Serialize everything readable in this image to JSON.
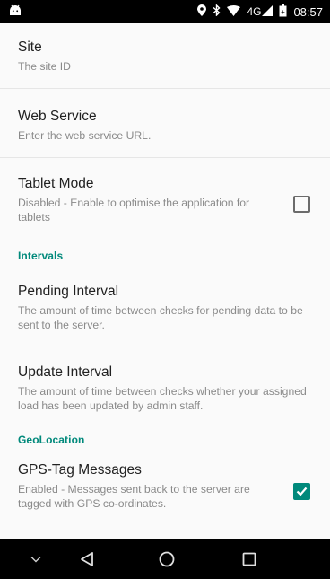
{
  "status_bar": {
    "time": "08:57",
    "network": "4G",
    "icons": [
      "android-icon",
      "location-icon",
      "bluetooth-icon",
      "wifi-icon",
      "signal-icon",
      "battery-icon"
    ]
  },
  "preferences": {
    "site": {
      "title": "Site",
      "summary": "The site ID"
    },
    "web_service": {
      "title": "Web Service",
      "summary": "Enter the web service URL."
    },
    "tablet_mode": {
      "title": "Tablet Mode",
      "summary": "Disabled - Enable to optimise the application for tablets",
      "checked": false
    },
    "intervals_category": "Intervals",
    "pending_interval": {
      "title": "Pending Interval",
      "summary": "The amount of time between checks for pending data to be sent to the server."
    },
    "update_interval": {
      "title": "Update Interval",
      "summary": "The amount of time between checks whether your assigned load has been updated by admin staff."
    },
    "geolocation_category": "GeoLocation",
    "gps_tag": {
      "title": "GPS-Tag Messages",
      "summary": "Enabled - Messages sent back to the server are tagged with GPS co-ordinates.",
      "checked": true
    }
  },
  "colors": {
    "accent": "#00897b",
    "status_bar": "#000000",
    "nav_bar": "#000000",
    "background": "#fafafa"
  },
  "nav_bar": {
    "icons": [
      "chevron-down-icon",
      "back-icon",
      "home-icon",
      "recents-icon"
    ]
  }
}
